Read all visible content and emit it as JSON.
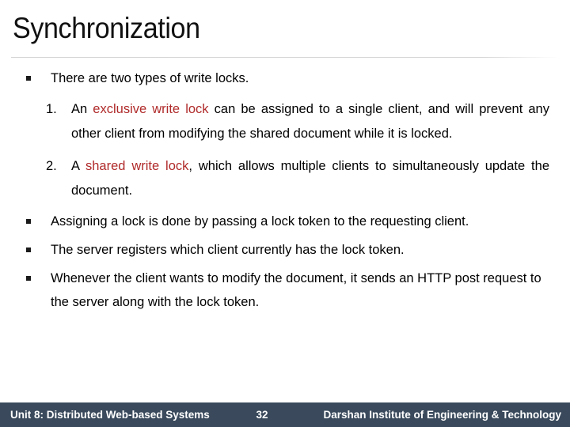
{
  "slide": {
    "title": "Synchronization",
    "accent_red": "#b02a2a",
    "footer_bg": "#3a4a5c",
    "bullet_glyph": "square"
  },
  "body": {
    "bullet1": {
      "text": "There are two types of write locks."
    },
    "numbered": [
      {
        "marker": "1.",
        "pre": "An ",
        "highlight": "exclusive write lock",
        "post": " can be assigned to a single client, and will prevent any other client from modifying the shared document while it is locked."
      },
      {
        "marker": "2.",
        "pre": "A ",
        "highlight": "shared write lock",
        "post": ", which allows multiple clients to simultaneously update the document."
      }
    ],
    "bullet2": {
      "text": "Assigning a lock is done by passing a lock token to the requesting client."
    },
    "bullet3": {
      "text": "The server registers which client currently has the lock token."
    },
    "bullet4": {
      "text": "Whenever the client wants to modify the document, it sends an HTTP post request to the server along with the lock token."
    }
  },
  "footer": {
    "unit": "Unit 8: Distributed Web-based Systems",
    "page": "32",
    "institute": "Darshan Institute of Engineering & Technology"
  }
}
